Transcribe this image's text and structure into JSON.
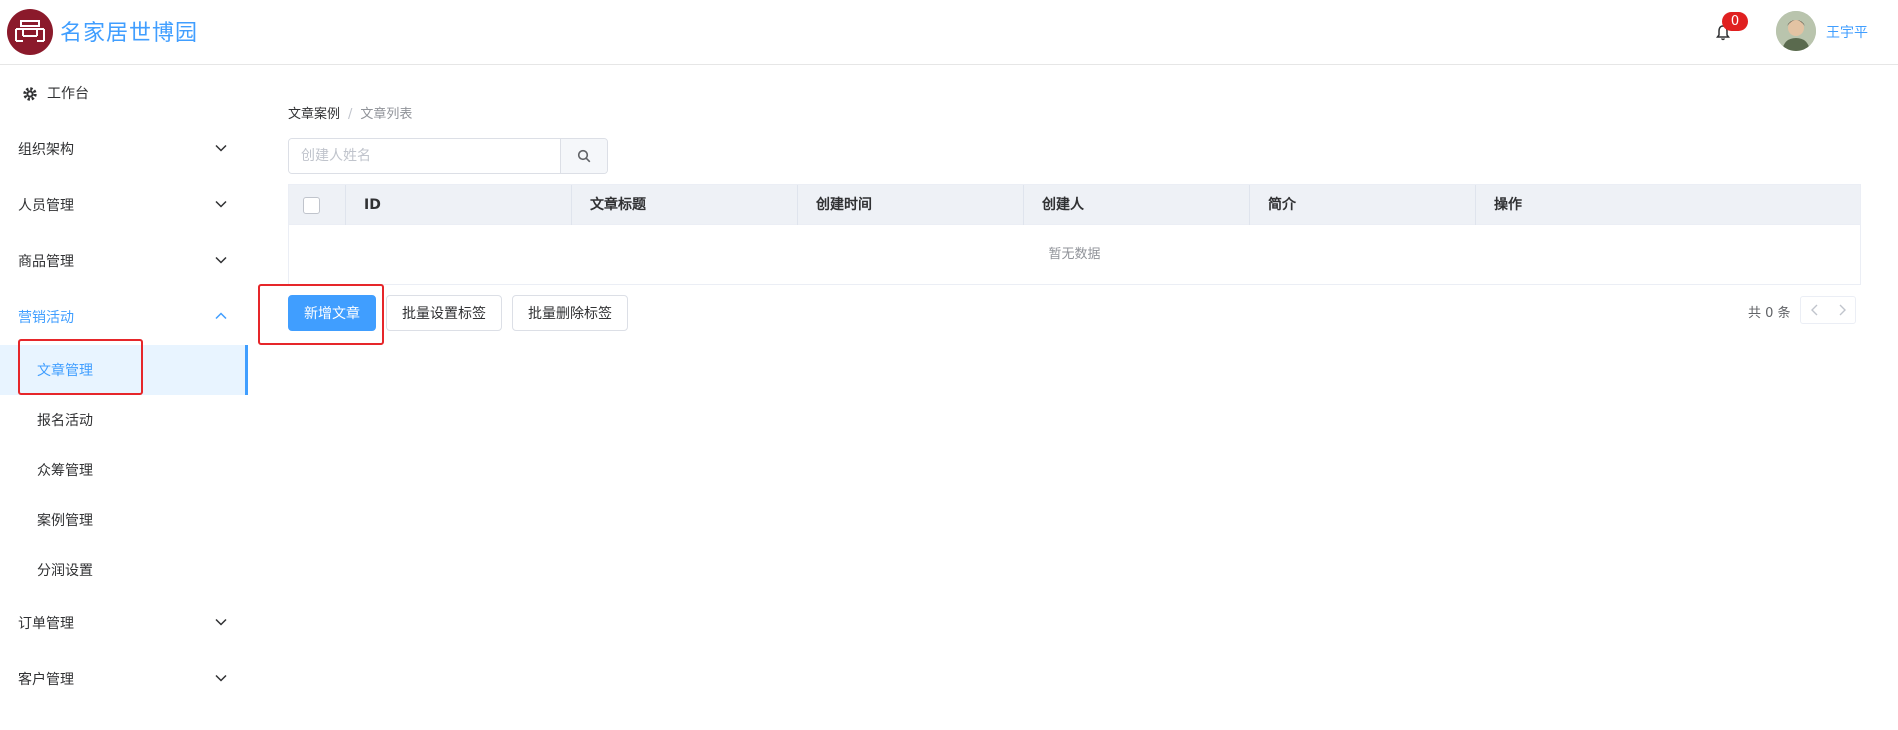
{
  "header": {
    "logo_text": "名家居世博园",
    "notification_count": "0",
    "username": "王宇平"
  },
  "sidebar": {
    "workbench": "工作台",
    "items": [
      {
        "label": "组织架构"
      },
      {
        "label": "人员管理"
      },
      {
        "label": "商品管理"
      },
      {
        "label": "营销活动"
      },
      {
        "label": "订单管理"
      },
      {
        "label": "客户管理"
      }
    ],
    "marketing_sub": [
      {
        "label": "文章管理"
      },
      {
        "label": "报名活动"
      },
      {
        "label": "众筹管理"
      },
      {
        "label": "案例管理"
      },
      {
        "label": "分润设置"
      }
    ]
  },
  "breadcrumb": {
    "parent": "文章案例",
    "separator": "/",
    "current": "文章列表"
  },
  "search": {
    "placeholder": "创建人姓名"
  },
  "table": {
    "columns": [
      "ID",
      "文章标题",
      "创建时间",
      "创建人",
      "简介",
      "操作"
    ],
    "empty_text": "暂无数据"
  },
  "actions": {
    "add_article": "新增文章",
    "batch_tag": "批量设置标签",
    "batch_delete_tag": "批量删除标签"
  },
  "pagination": {
    "total_text": "共 0 条"
  },
  "colors": {
    "primary": "#409eff",
    "logo_bg": "#8b1a2b",
    "badge": "#e02020",
    "highlight": "#e6262a"
  }
}
